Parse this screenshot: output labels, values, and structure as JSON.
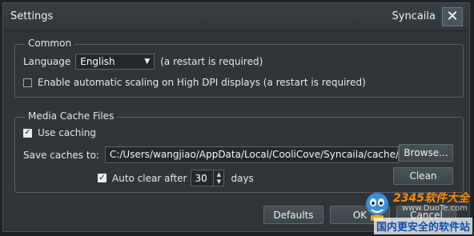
{
  "window": {
    "title": "Settings",
    "app_name": "Syncaila",
    "close_glyph": "✕"
  },
  "common": {
    "group_title": "Common",
    "language_label": "Language",
    "language_value": "English",
    "restart_note": "(a restart is required)",
    "dpi_label": "Enable automatic scaling on High DPI displays (a restart is required)",
    "dpi_checked": false
  },
  "media_cache": {
    "group_title": "Media Cache Files",
    "use_caching_label": "Use caching",
    "use_caching_checked": true,
    "save_caches_label": "Save caches to:",
    "path_value": "C:/Users/wangjiao/AppData/Local/CooliCove/Syncaila/cache/",
    "browse_label": "Browse...",
    "auto_clear_label": "Auto clear after",
    "auto_clear_checked": true,
    "auto_clear_days": "30",
    "days_label": "days",
    "clean_label": "Clean"
  },
  "footer": {
    "defaults_label": "Defaults",
    "ok_label": "OK",
    "cancel_label": "Cancel"
  },
  "watermark": {
    "logo": "2345软件大全",
    "url": "www.DuoTe.com",
    "text": "国内更安全的软件站"
  },
  "icons": {
    "dropdown": "chevron-down-icon",
    "checkmark": "checkmark-icon",
    "spin_up": "spin-up-icon",
    "spin_down": "spin-down-icon",
    "close": "close-icon"
  }
}
